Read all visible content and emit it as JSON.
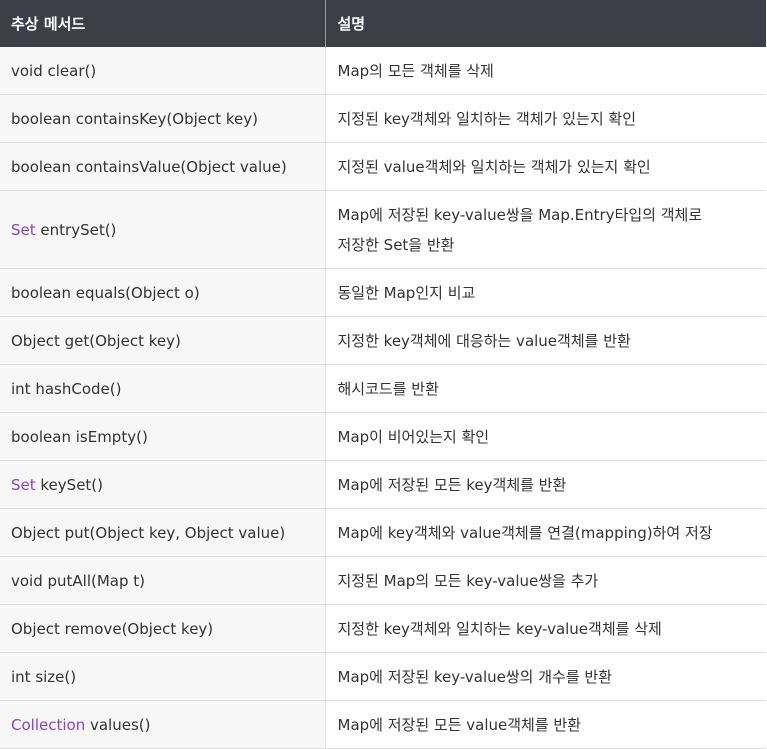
{
  "header": {
    "method_col": "추상 메서드",
    "desc_col": "설명"
  },
  "rows": [
    {
      "pre": "",
      "rest": "void clear()",
      "desc": "Map의 모든 객체를 삭제"
    },
    {
      "pre": "",
      "rest": "boolean containsKey(Object key)",
      "desc": "지정된 key객체와 일치하는 객체가 있는지 확인"
    },
    {
      "pre": "",
      "rest": "boolean containsValue(Object value)",
      "desc": "지정된 value객체와 일치하는 객체가 있는지 확인"
    },
    {
      "pre": "Set",
      "rest": " entrySet()",
      "desc_line1": "Map에 저장된 key-value쌍을 Map.Entry타입의 객체로",
      "desc_line2": "저장한 Set을 반환"
    },
    {
      "pre": "",
      "rest": "boolean equals(Object o)",
      "desc": "동일한 Map인지 비교"
    },
    {
      "pre": "",
      "rest": "Object get(Object key)",
      "desc": "지정한 key객체에 대응하는 value객체를 반환"
    },
    {
      "pre": "",
      "rest": "int hashCode()",
      "desc": "해시코드를 반환"
    },
    {
      "pre": "",
      "rest": "boolean isEmpty()",
      "desc": "Map이 비어있는지 확인"
    },
    {
      "pre": "Set",
      "rest": " keySet()",
      "desc": "Map에 저장된 모든 key객체를 반환"
    },
    {
      "pre": "",
      "rest": "Object put(Object key, Object value)",
      "desc": "Map에 key객체와 value객체를 연결(mapping)하여 저장"
    },
    {
      "pre": "",
      "rest": "void putAll(Map t)",
      "desc": "지정된 Map의 모든 key-value쌍을 추가"
    },
    {
      "pre": "",
      "rest": "Object remove(Object key)",
      "desc": "지정한 key객체와 일치하는 key-value객체를 삭제"
    },
    {
      "pre": "",
      "rest": "int size()",
      "desc": "Map에 저장된 key-value쌍의 개수를 반환"
    },
    {
      "pre": "Collection",
      "rest": " values()",
      "desc": "Map에 저장된 모든 value객체를 반환"
    }
  ],
  "colors": {
    "header_bg": "#3c3f47",
    "highlight": "#8b3fd9"
  }
}
